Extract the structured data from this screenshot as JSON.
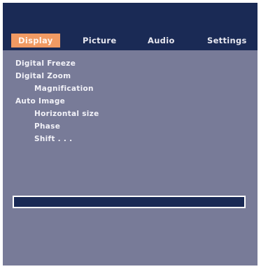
{
  "tabs": {
    "display": "Display",
    "picture": "Picture",
    "audio": "Audio",
    "settings": "Settings"
  },
  "menu": {
    "items": [
      {
        "label": "Digital Freeze",
        "level": 1
      },
      {
        "label": "Digital Zoom",
        "level": 1
      },
      {
        "label": "Magnification",
        "level": 2
      },
      {
        "label": "Auto Image",
        "level": 1
      },
      {
        "label": "Horizontal size",
        "level": 2
      },
      {
        "label": "Phase",
        "level": 2
      },
      {
        "label": "Shift . . .",
        "level": 2
      }
    ]
  },
  "status_bar": {
    "text": ""
  },
  "colors": {
    "panel_background": "#787b98",
    "header_background": "#1a2a55",
    "active_tab": "#f19a63",
    "text": "#f2f2f8"
  }
}
